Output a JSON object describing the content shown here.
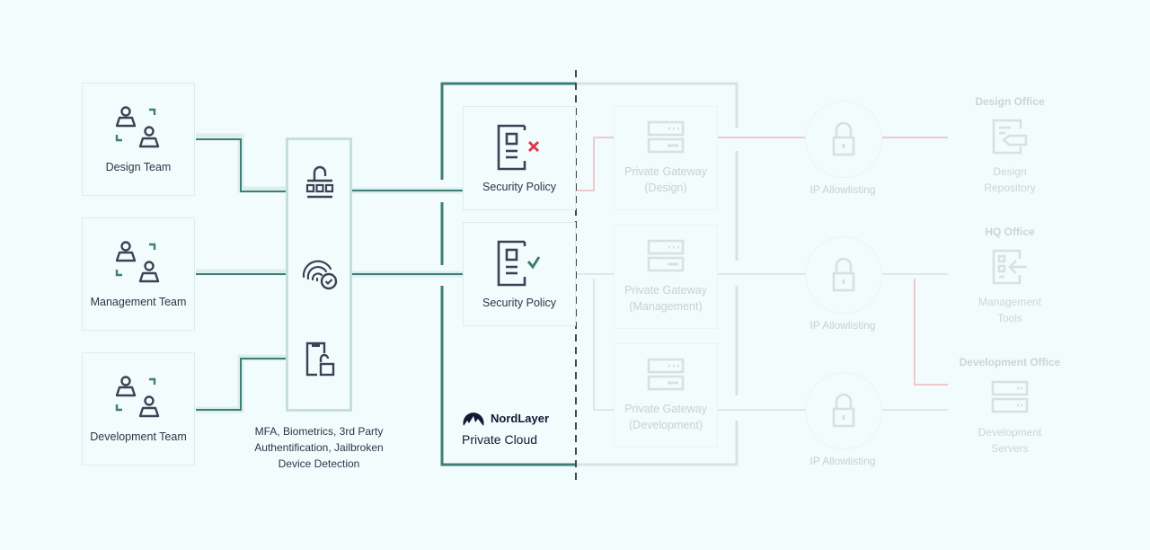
{
  "colors": {
    "background": "#f2fcfd",
    "accent_teal": "#3d7f77",
    "icon_dark": "#3c4256",
    "deny_red": "#e0384b",
    "faded_gray": "#c4d1d3",
    "faded_red": "#f0c9cc"
  },
  "teams": [
    {
      "label": "Design Team",
      "icon": "team-icon"
    },
    {
      "label": "Management Team",
      "icon": "team-icon"
    },
    {
      "label": "Development Team",
      "icon": "team-icon"
    }
  ],
  "auth": {
    "icons": [
      "padlock-keypad-icon",
      "fingerprint-check-icon",
      "jailbroken-device-icon"
    ],
    "caption_lines": [
      "MFA, Biometrics, 3rd Party",
      "Authentification, Jailbroken",
      "Device Detection"
    ]
  },
  "policies": [
    {
      "label": "Security Policy",
      "status": "denied",
      "icon": "policy-deny-icon"
    },
    {
      "label": "Security Policy",
      "status": "allowed",
      "icon": "policy-allow-icon"
    }
  ],
  "private_cloud": {
    "brand": "NordLayer",
    "label": "Private Cloud"
  },
  "gateways": [
    {
      "line1": "Private Gateway",
      "line2": "(Design)"
    },
    {
      "line1": "Private Gateway",
      "line2": "(Management)"
    },
    {
      "line1": "Private Gateway",
      "line2": "(Development)"
    }
  ],
  "ip_allowlisting": [
    {
      "label": "IP Allowlisting"
    },
    {
      "label": "IP Allowlisting"
    },
    {
      "label": "IP Allowlisting"
    }
  ],
  "offices": [
    {
      "title": "Design Office",
      "resource_line1": "Design",
      "resource_line2": "Repository",
      "icon": "design-repository-icon"
    },
    {
      "title": "HQ Office",
      "resource_line1": "Management",
      "resource_line2": "Tools",
      "icon": "management-tools-icon"
    },
    {
      "title": "Development Office",
      "resource_line1": "Development",
      "resource_line2": "Servers",
      "icon": "development-servers-icon"
    }
  ]
}
